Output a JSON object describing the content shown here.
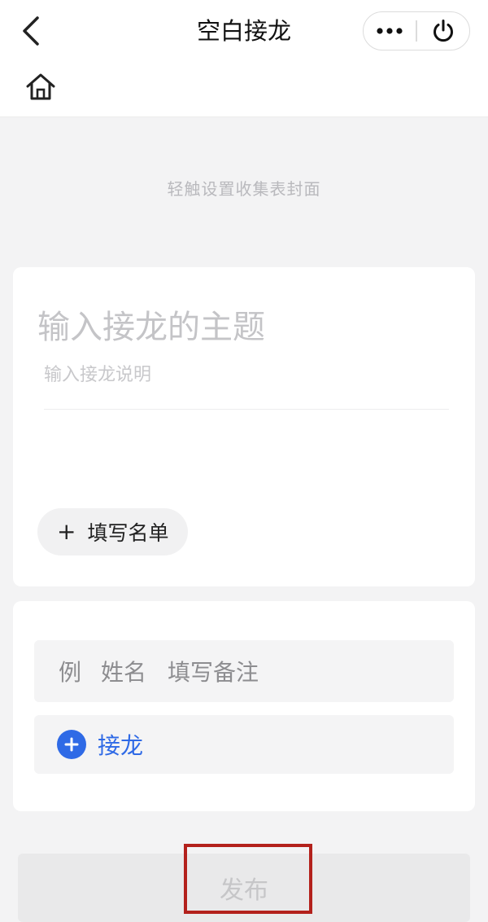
{
  "header": {
    "title": "空白接龙",
    "back_icon": "chevron-left-icon",
    "more_icon": "more-dots-icon",
    "power_icon": "power-icon",
    "home_icon": "home-icon"
  },
  "cover": {
    "hint": "轻触设置收集表封面"
  },
  "form": {
    "topic_placeholder": "输入接龙的主题",
    "desc_placeholder": "输入接龙说明",
    "fill_list_label": "填写名单"
  },
  "list": {
    "example_label": "例",
    "example_name": "姓名",
    "example_note": "填写备注",
    "join_label": "接龙"
  },
  "footer": {
    "publish_label": "发布"
  },
  "colors": {
    "accent": "#2f6ae6",
    "highlight": "#b3211c",
    "background": "#f3f3f4"
  }
}
